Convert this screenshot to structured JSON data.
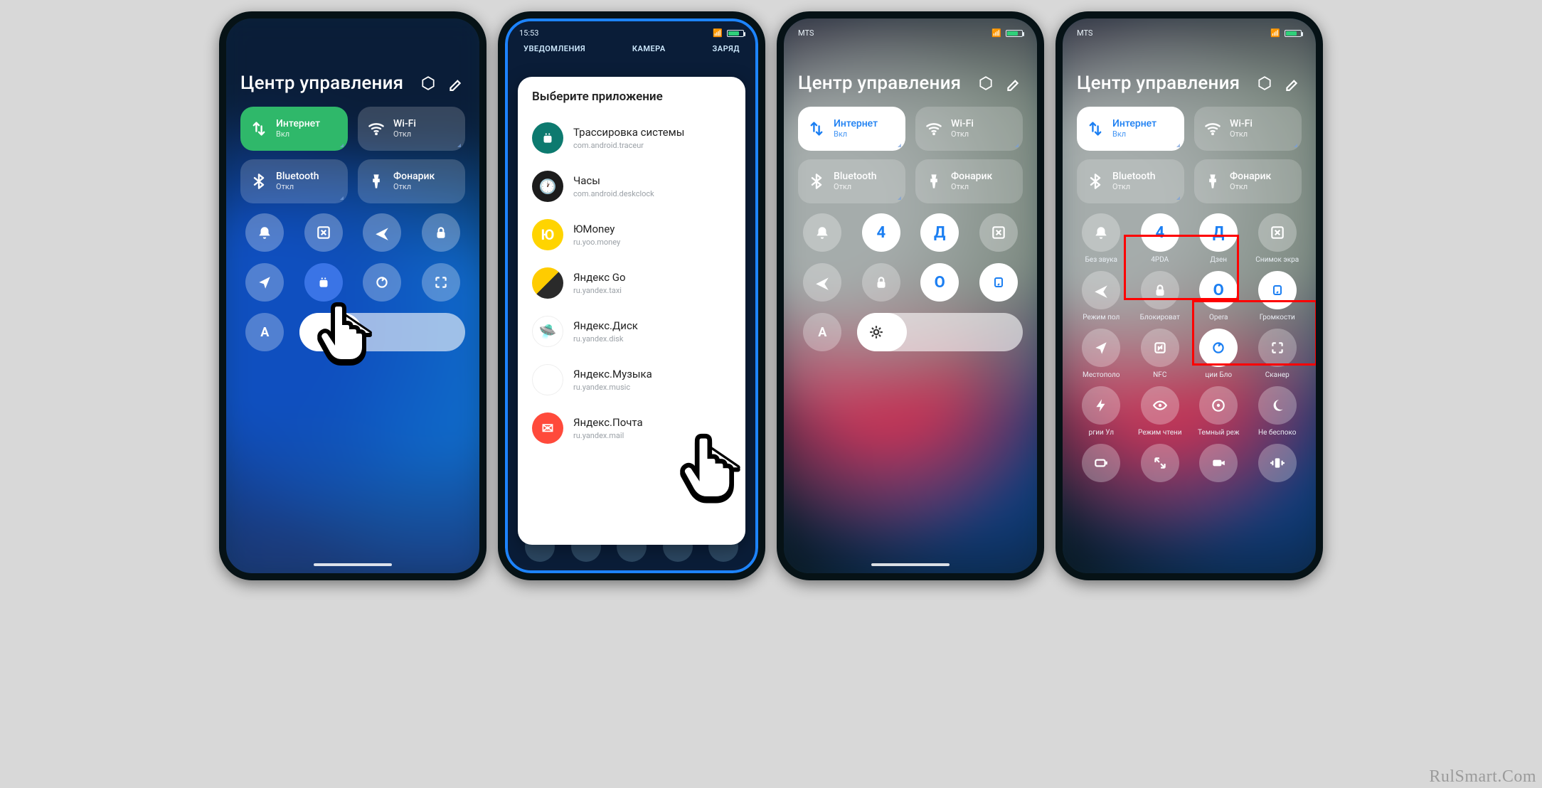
{
  "watermark": "RulSmart.Com",
  "cc_title": "Центр управления",
  "tiles": {
    "internet": {
      "label": "Интернет",
      "sub": "Вкл"
    },
    "wifi": {
      "label": "Wi-Fi",
      "sub": "Откл"
    },
    "bt": {
      "label": "Bluetooth",
      "sub": "Откл"
    },
    "torch": {
      "label": "Фонарик",
      "sub": "Откл"
    }
  },
  "p2": {
    "time": "15:53",
    "tabs": {
      "a": "УВЕДОМЛЕНИЯ",
      "b": "КАМЕРА",
      "c": "ЗАРЯД"
    },
    "panel_title": "Выберите приложение",
    "apps": [
      {
        "name": "Трассировка системы",
        "pkg": "com.android.traceur"
      },
      {
        "name": "Часы",
        "pkg": "com.android.deskclock"
      },
      {
        "name": "ЮMoney",
        "pkg": "ru.yoo.money"
      },
      {
        "name": "Яндекс Go",
        "pkg": "ru.yandex.taxi"
      },
      {
        "name": "Яндекс.Диск",
        "pkg": "ru.yandex.disk"
      },
      {
        "name": "Яндекс.Музыка",
        "pkg": "ru.yandex.music"
      },
      {
        "name": "Яндекс.Почта",
        "pkg": "ru.yandex.mail"
      }
    ]
  },
  "p3": {
    "carrier": "MTS",
    "shortcuts": {
      "s4": "4",
      "sd": "Д",
      "so": "O"
    }
  },
  "p4": {
    "carrier": "MTS",
    "shortcuts": {
      "s4": "4",
      "sd": "Д",
      "so": "O"
    },
    "labels": {
      "silent": "Без звука",
      "pda": "4PDA",
      "dzen": "Дзен",
      "shot": "Снимок экра",
      "plane": "Режим пол",
      "lock": "Блокироват",
      "opera": "Opera",
      "volume": "Громкости",
      "loc": "Местополо",
      "nfc": "NFC",
      "cii": "ции   Бло",
      "scan": "Сканер",
      "pwr": "ргии    Ул",
      "read": "Режим чтени",
      "dark": "Темный реж",
      "dnd": "Не беспоко"
    }
  }
}
